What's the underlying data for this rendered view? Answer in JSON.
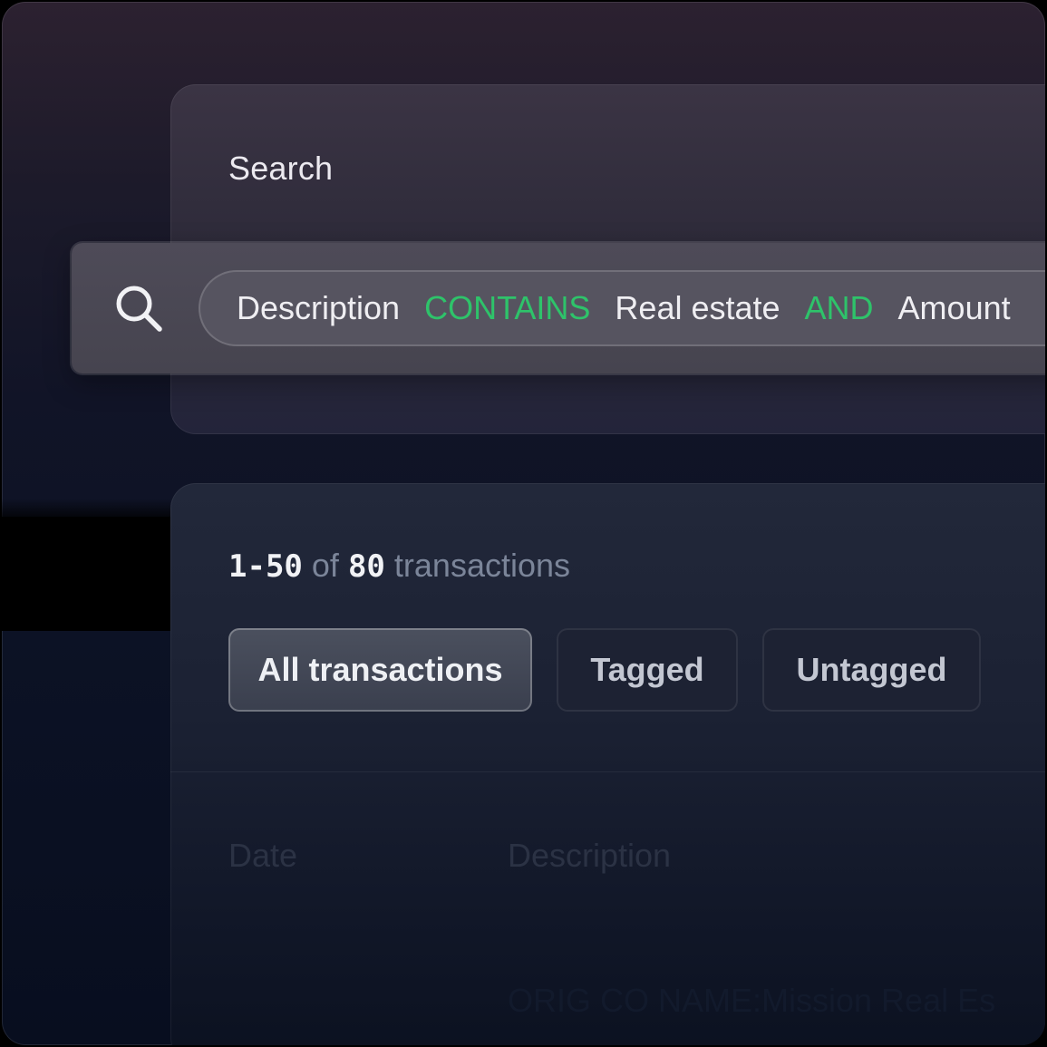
{
  "search": {
    "title": "Search",
    "query_tokens": [
      {
        "text": "Description",
        "kind": "field"
      },
      {
        "text": "CONTAINS",
        "kind": "operator"
      },
      {
        "text": "Real estate",
        "kind": "value"
      },
      {
        "text": "AND",
        "kind": "operator"
      },
      {
        "text": "Amount",
        "kind": "field"
      }
    ],
    "icon": "search-icon"
  },
  "transactions": {
    "range": "1-50",
    "of_label": "of",
    "total": "80",
    "noun": "transactions",
    "filters": [
      {
        "label": "All transactions",
        "active": true
      },
      {
        "label": "Tagged",
        "active": false
      },
      {
        "label": "Untagged",
        "active": false
      }
    ],
    "columns": [
      "Date",
      "Description"
    ],
    "first_row_description": "ORIG CO NAME:Mission Real Es"
  },
  "colors": {
    "operator": "#2ec36a",
    "text_primary": "#efeef2",
    "text_muted": "#7b8599"
  }
}
